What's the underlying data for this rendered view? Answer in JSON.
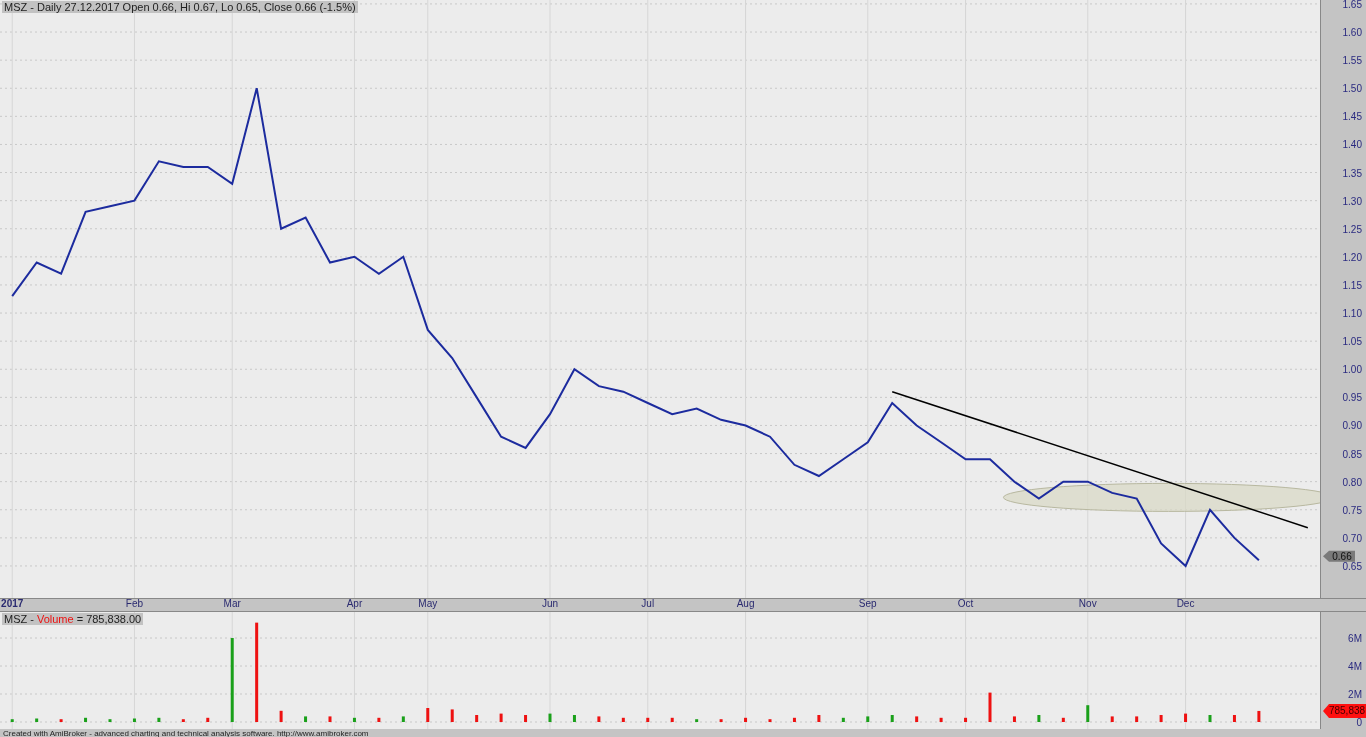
{
  "price_title": "MSZ - Daily 27.12.2017 Open 0.66, Hi 0.67, Lo 0.65, Close 0.66 (-1.5%)",
  "price_chart": {
    "chart_data": {
      "type": "line",
      "grid": true,
      "categories": [
        "2017",
        null,
        null,
        null,
        null,
        "Feb",
        null,
        null,
        null,
        "Mar",
        null,
        null,
        null,
        null,
        "Apr",
        null,
        null,
        "May",
        null,
        null,
        null,
        null,
        "Jun",
        null,
        null,
        null,
        "Jul",
        null,
        null,
        null,
        "Aug",
        null,
        null,
        null,
        null,
        "Sep",
        null,
        null,
        null,
        "Oct",
        null,
        null,
        null,
        null,
        "Nov",
        null,
        null,
        null,
        "Dec",
        null,
        null,
        null,
        null,
        null
      ],
      "series": [
        {
          "color": "#1c2b9e",
          "values": [
            1.13,
            1.19,
            1.17,
            1.28,
            1.29,
            1.3,
            1.37,
            1.36,
            1.36,
            1.33,
            1.5,
            1.25,
            1.27,
            1.19,
            1.2,
            1.17,
            1.2,
            1.07,
            1.02,
            0.95,
            0.88,
            0.86,
            0.92,
            1.0,
            0.97,
            0.96,
            0.94,
            0.92,
            0.93,
            0.91,
            0.9,
            0.88,
            0.83,
            0.81,
            0.84,
            0.87,
            0.94,
            0.9,
            0.87,
            0.84,
            0.84,
            0.8,
            0.77,
            0.8,
            0.8,
            0.78,
            0.77,
            0.69,
            0.65,
            0.75,
            0.7,
            0.66,
            null,
            null
          ]
        },
        {
          "color": "#000000",
          "values": [
            null,
            null,
            null,
            null,
            null,
            null,
            null,
            null,
            null,
            null,
            null,
            null,
            null,
            null,
            null,
            null,
            null,
            null,
            null,
            null,
            null,
            null,
            null,
            null,
            null,
            null,
            null,
            null,
            null,
            null,
            null,
            null,
            null,
            null,
            null,
            null,
            0.96,
            null,
            null,
            null,
            null,
            null,
            null,
            null,
            null,
            null,
            null,
            null,
            null,
            null,
            null,
            null,
            null,
            0.718
          ]
        }
      ],
      "ylim": [
        0.593,
        1.657
      ],
      "yticks": [
        {
          "value": 1.65,
          "label": "1.65"
        },
        {
          "value": 1.6,
          "label": "1.60"
        },
        {
          "value": 1.55,
          "label": "1.55"
        },
        {
          "value": 1.5,
          "label": "1.50"
        },
        {
          "value": 1.45,
          "label": "1.45"
        },
        {
          "value": 1.4,
          "label": "1.40"
        },
        {
          "value": 1.35,
          "label": "1.35"
        },
        {
          "value": 1.3,
          "label": "1.30"
        },
        {
          "value": 1.25,
          "label": "1.25"
        },
        {
          "value": 1.2,
          "label": "1.20"
        },
        {
          "value": 1.15,
          "label": "1.15"
        },
        {
          "value": 1.1,
          "label": "1.10"
        },
        {
          "value": 1.05,
          "label": "1.05"
        },
        {
          "value": 1.0,
          "label": "1.00"
        },
        {
          "value": 0.95,
          "label": "0.95"
        },
        {
          "value": 0.9,
          "label": "0.90"
        },
        {
          "value": 0.85,
          "label": "0.85"
        },
        {
          "value": 0.8,
          "label": "0.80"
        },
        {
          "value": 0.75,
          "label": "0.75"
        },
        {
          "value": 0.7,
          "label": "0.70"
        },
        {
          "value": 0.65,
          "label": "0.65"
        }
      ]
    },
    "overlays": [
      {
        "kind": "ellipse"
      }
    ],
    "last_value_tag": "0.66"
  },
  "volume_title": {
    "prefix": "MSZ -",
    "name": "Volume",
    "value": "= 785,838.00"
  },
  "volume_chart": {
    "chart_data": {
      "type": "bar",
      "stacked": true,
      "grid": true,
      "categories": [
        null,
        null,
        null,
        null,
        null,
        null,
        null,
        null,
        null,
        null,
        null,
        null,
        null,
        null,
        null,
        null,
        null,
        null,
        null,
        null,
        null,
        null,
        null,
        null,
        null,
        null,
        null,
        null,
        null,
        null,
        null,
        null,
        null,
        null,
        null,
        null,
        null,
        null,
        null,
        null,
        null,
        null,
        null,
        null,
        null,
        null,
        null,
        null,
        null,
        null,
        null,
        null,
        null,
        null
      ],
      "series": [
        {
          "color": "#1aa01a",
          "values": [
            0.2,
            0.25,
            null,
            0.3,
            0.2,
            0.25,
            0.3,
            null,
            null,
            6.0,
            null,
            null,
            0.4,
            null,
            0.3,
            null,
            0.4,
            null,
            null,
            null,
            null,
            null,
            0.6,
            0.5,
            null,
            null,
            null,
            null,
            0.2,
            null,
            null,
            null,
            null,
            null,
            0.3,
            0.4,
            0.5,
            null,
            null,
            null,
            null,
            null,
            0.5,
            null,
            1.2,
            null,
            null,
            null,
            null,
            0.5,
            null,
            null,
            null,
            null
          ]
        },
        {
          "color": "#ee1111",
          "values": [
            null,
            null,
            0.2,
            null,
            null,
            null,
            null,
            0.2,
            0.3,
            null,
            7.1,
            0.8,
            null,
            0.4,
            null,
            0.3,
            null,
            1.0,
            0.9,
            0.5,
            0.6,
            0.5,
            null,
            null,
            0.4,
            0.3,
            0.3,
            0.3,
            null,
            0.2,
            0.3,
            0.2,
            0.3,
            0.5,
            null,
            null,
            null,
            0.4,
            0.3,
            0.3,
            2.1,
            0.4,
            null,
            0.3,
            null,
            0.4,
            0.4,
            0.5,
            0.6,
            null,
            0.5,
            0.79,
            null,
            null
          ]
        }
      ],
      "ylim": [
        0,
        7.86
      ],
      "yticks": [
        {
          "value": 6,
          "label": "6M"
        },
        {
          "value": 4,
          "label": "4M"
        },
        {
          "value": 2,
          "label": "2M"
        },
        {
          "value": 0,
          "label": "0"
        }
      ]
    },
    "last_value_tag": "785,838"
  },
  "footer": "Created with AmiBroker - advanced charting and technical analysis software. http://www.amibroker.com"
}
